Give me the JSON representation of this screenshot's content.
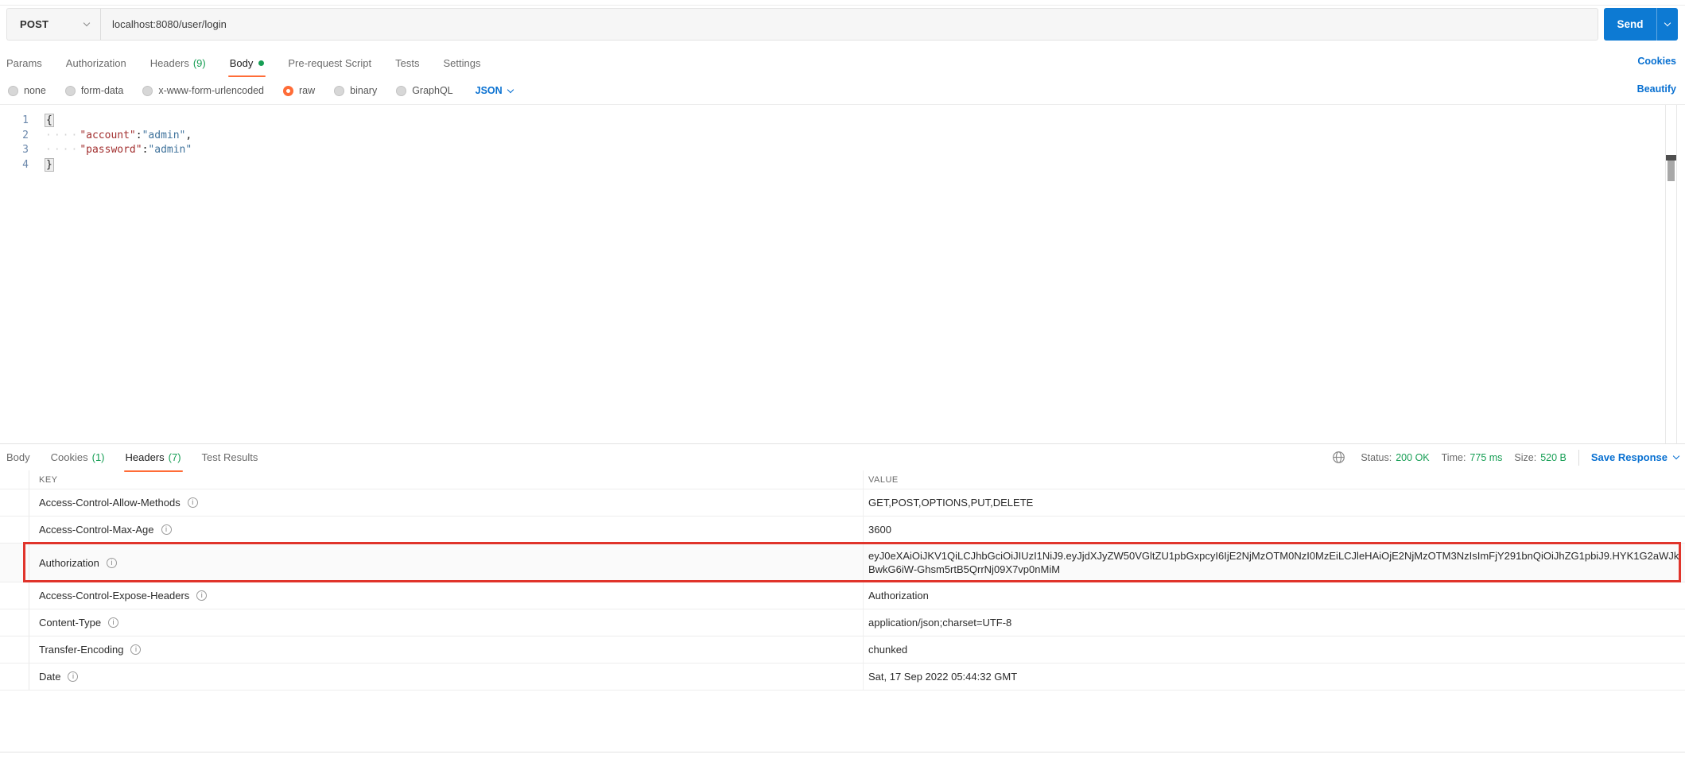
{
  "request": {
    "method": "POST",
    "url": "localhost:8080/user/login",
    "send_button": "Send",
    "cookies_link": "Cookies",
    "tabs": [
      {
        "label": "Params"
      },
      {
        "label": "Authorization"
      },
      {
        "label": "Headers",
        "count": "(9)"
      },
      {
        "label": "Body"
      },
      {
        "label": "Pre-request Script"
      },
      {
        "label": "Tests"
      },
      {
        "label": "Settings"
      }
    ],
    "body": {
      "modes": [
        "none",
        "form-data",
        "x-www-form-urlencoded",
        "raw",
        "binary",
        "GraphQL"
      ],
      "selected_mode": "raw",
      "language": "JSON",
      "beautify_link": "Beautify",
      "editor": {
        "line_numbers": [
          "1",
          "2",
          "3",
          "4"
        ],
        "open_brace": "{",
        "close_brace": "}",
        "indent_dots": "····",
        "line2": {
          "key": "\"account\"",
          "colon": ":",
          "value": "\"admin\"",
          "comma": ","
        },
        "line3": {
          "key": "\"password\"",
          "colon": ":",
          "value": "\"admin\""
        }
      }
    }
  },
  "response": {
    "tabs": [
      {
        "label": "Body"
      },
      {
        "label": "Cookies",
        "count": "(1)"
      },
      {
        "label": "Headers",
        "count": "(7)"
      },
      {
        "label": "Test Results"
      }
    ],
    "status": {
      "label": "Status:",
      "value": "200 OK"
    },
    "time": {
      "label": "Time:",
      "value": "775 ms"
    },
    "size": {
      "label": "Size:",
      "value": "520 B"
    },
    "save_response_label": "Save Response",
    "headers_table": {
      "key_header": "KEY",
      "value_header": "VALUE",
      "rows": [
        {
          "key": "Access-Control-Allow-Methods",
          "value": "GET,POST,OPTIONS,PUT,DELETE"
        },
        {
          "key": "Access-Control-Max-Age",
          "value": "3600"
        },
        {
          "key": "Authorization",
          "value": "eyJ0eXAiOiJKV1QiLCJhbGciOiJIUzI1NiJ9.eyJjdXJyZW50VGltZU1pbGxpcyI6IjE2NjMzOTM0NzI0MzEiLCJleHAiOjE2NjMzOTM3NzIsImFjY291bnQiOiJhZG1pbiJ9.HYK1G2aWJkBwkG6iW-Ghsm5rtB5QrrNj09X7vp0nMiM",
          "highlighted": true
        },
        {
          "key": "Access-Control-Expose-Headers",
          "value": "Authorization"
        },
        {
          "key": "Content-Type",
          "value": "application/json;charset=UTF-8"
        },
        {
          "key": "Transfer-Encoding",
          "value": "chunked"
        },
        {
          "key": "Date",
          "value": "Sat, 17 Sep 2022 05:44:32 GMT"
        }
      ]
    }
  },
  "icons": {
    "info_char": "i"
  },
  "colors": {
    "accent_orange": "#ff6c37",
    "success_green": "#169e54",
    "link_blue": "#0870d1",
    "send_button_blue": "#0d7ad3",
    "highlight_red": "#e0342b"
  }
}
